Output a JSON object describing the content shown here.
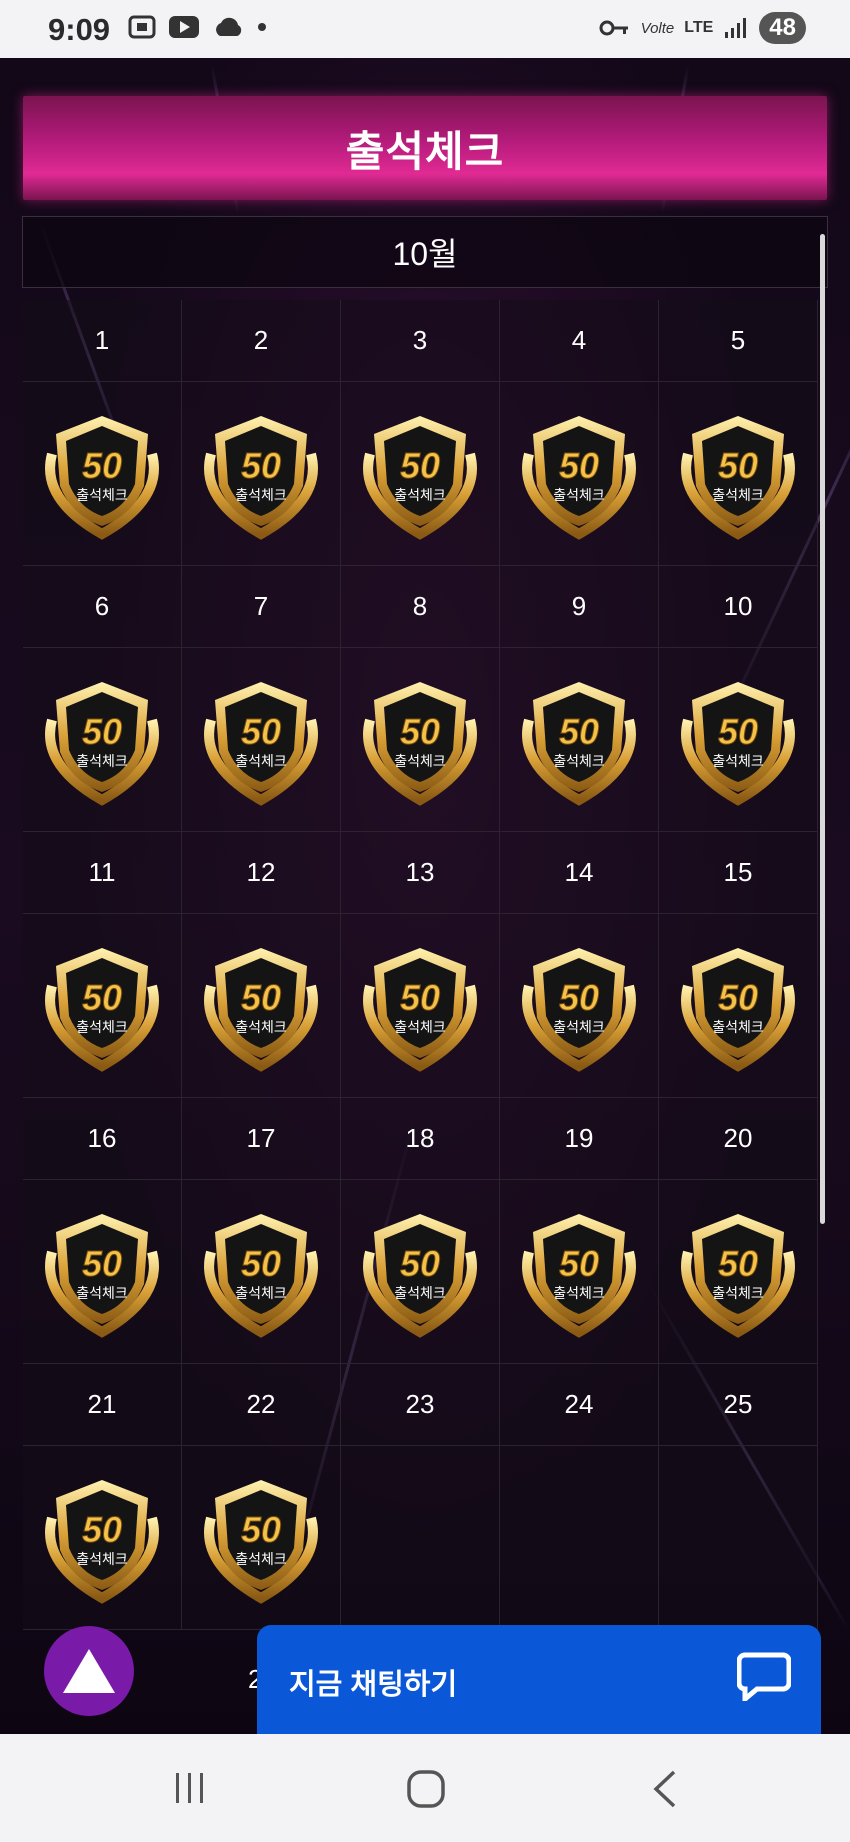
{
  "status": {
    "time": "9:09",
    "battery": "48",
    "network": "LTE",
    "carrier_tag": "Volte"
  },
  "header": {
    "title": "출석체크"
  },
  "calendar": {
    "month": "10월",
    "badge_text": "출석체크",
    "badge_points": "50",
    "weeks": [
      {
        "days": [
          "1",
          "2",
          "3",
          "4",
          "5"
        ],
        "checked": [
          true,
          true,
          true,
          true,
          true
        ]
      },
      {
        "days": [
          "6",
          "7",
          "8",
          "9",
          "10"
        ],
        "checked": [
          true,
          true,
          true,
          true,
          true
        ]
      },
      {
        "days": [
          "11",
          "12",
          "13",
          "14",
          "15"
        ],
        "checked": [
          true,
          true,
          true,
          true,
          true
        ]
      },
      {
        "days": [
          "16",
          "17",
          "18",
          "19",
          "20"
        ],
        "checked": [
          true,
          true,
          true,
          true,
          true
        ]
      },
      {
        "days": [
          "21",
          "22",
          "23",
          "24",
          "25"
        ],
        "checked": [
          true,
          true,
          false,
          false,
          false
        ]
      }
    ],
    "partial_next_day": "2"
  },
  "chat": {
    "label": "지금 채팅하기"
  },
  "colors": {
    "header": "#d0207f",
    "chat": "#0a58d8",
    "fab": "#7a1aa8"
  },
  "icons": [
    "camera-icon",
    "youtube-icon",
    "cloud-icon",
    "key-icon",
    "signal-icon",
    "chat-bubble-icon",
    "up-triangle-icon",
    "recent-apps-icon",
    "home-icon",
    "back-icon"
  ]
}
